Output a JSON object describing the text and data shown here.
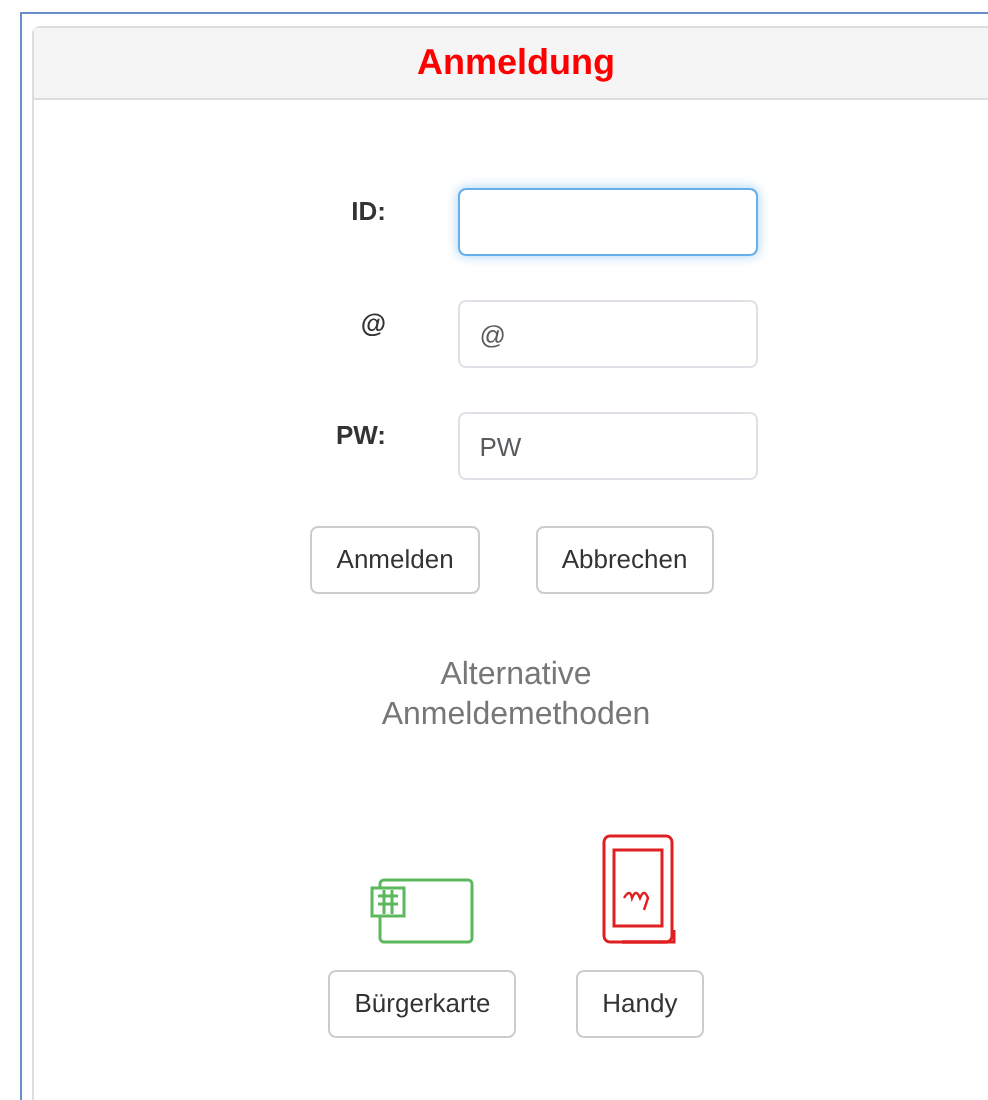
{
  "panel": {
    "title": "Anmeldung"
  },
  "fields": [
    {
      "label": "ID:",
      "focused": true
    },
    {
      "label": "@",
      "placeholder": "@",
      "focused": false
    },
    {
      "label": "PW:",
      "placeholder": "PW",
      "focused": false
    }
  ],
  "buttons": [
    "Anmelden",
    "Abbrechen"
  ],
  "alternative_heading": "Alternative Anmeldemethoden",
  "methods": [
    {
      "kind": "card",
      "label": "Bürgerkarte"
    },
    {
      "kind": "phone",
      "label": "Handy"
    }
  ]
}
